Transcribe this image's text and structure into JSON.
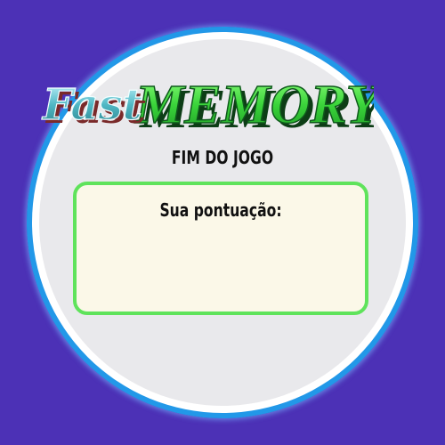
{
  "logo": {
    "word_fast": "Fast",
    "word_memory": "MEMORY"
  },
  "screen": {
    "subtitle": "FIM DO JOGO",
    "score_label": "Sua pontuação:"
  },
  "colors": {
    "background": "#4c31b6",
    "ring": "#1e90e6",
    "panel_border": "#5fe35b",
    "memory_green": "#3ad43a",
    "fast_teal": "#4fb7c4"
  }
}
